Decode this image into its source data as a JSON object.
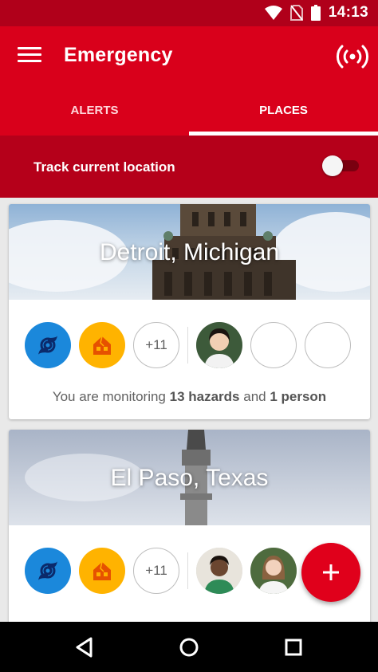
{
  "status_bar": {
    "time": "14:13"
  },
  "app_bar": {
    "title": "Emergency",
    "tabs": [
      {
        "label": "ALERTS",
        "active": false
      },
      {
        "label": "PLACES",
        "active": true
      }
    ]
  },
  "track": {
    "label": "Track current location",
    "enabled": false
  },
  "places": [
    {
      "city": "Detroit, Michigan",
      "hazard_icons": [
        "hurricane-icon",
        "house-damage-icon"
      ],
      "extra_count": "+11",
      "monitor_prefix": "You are monitoring ",
      "monitor_hazards": "13 hazards",
      "monitor_and": " and ",
      "monitor_people": "1 person"
    },
    {
      "city": "El Paso, Texas",
      "hazard_icons": [
        "hurricane-icon",
        "house-damage-icon"
      ],
      "extra_count": "+11"
    }
  ],
  "colors": {
    "primary": "#d9001b",
    "primary_dark": "#b0001a",
    "hurricane": "#1b88db",
    "house": "#ffb300"
  }
}
